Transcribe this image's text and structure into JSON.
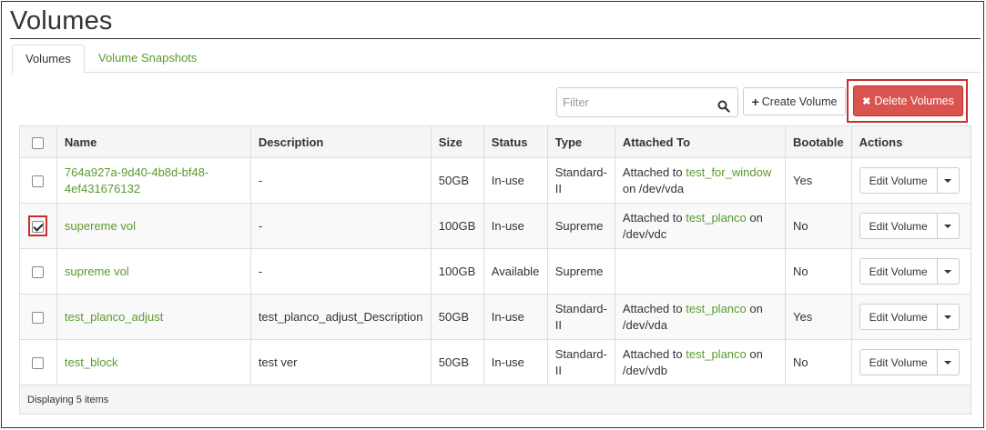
{
  "page": {
    "title": "Volumes"
  },
  "tabs": [
    {
      "label": "Volumes",
      "active": true
    },
    {
      "label": "Volume Snapshots",
      "active": false
    }
  ],
  "toolbar": {
    "filter_placeholder": "Filter",
    "create_label": "Create Volume",
    "delete_label": "Delete Volumes"
  },
  "table": {
    "headers": {
      "name": "Name",
      "description": "Description",
      "size": "Size",
      "status": "Status",
      "type": "Type",
      "attached": "Attached To",
      "bootable": "Bootable",
      "actions": "Actions"
    },
    "attached_prefix": "Attached to",
    "rows": [
      {
        "checked": false,
        "name_line1": "764a927a-9d40-4b8d-bf48-",
        "name_line2": "4ef431676132",
        "description": "-",
        "size": "50GB",
        "status": "In-use",
        "type_line1": "Standard-",
        "type_line2": "II",
        "attached_link": "test_for_window",
        "attached_on": "on /dev/vda",
        "bootable": "Yes",
        "action": "Edit Volume"
      },
      {
        "checked": true,
        "name_line1": "supereme vol",
        "name_line2": "",
        "description": "-",
        "size": "100GB",
        "status": "In-use",
        "type_line1": "Supreme",
        "type_line2": "",
        "attached_link": "test_planco",
        "attached_on": "on",
        "attached_line2": "/dev/vdc",
        "bootable": "No",
        "action": "Edit Volume"
      },
      {
        "checked": false,
        "name_line1": "supreme vol",
        "name_line2": "",
        "description": "-",
        "size": "100GB",
        "status": "Available",
        "type_line1": "Supreme",
        "type_line2": "",
        "bootable": "No",
        "action": "Edit Volume"
      },
      {
        "checked": false,
        "name_line1": "test_planco_adjust",
        "name_line2": "",
        "description": "test_planco_adjust_Description",
        "size": "50GB",
        "status": "In-use",
        "type_line1": "Standard-",
        "type_line2": "II",
        "attached_link": "test_planco",
        "attached_on": "on",
        "attached_line2": "/dev/vda",
        "bootable": "Yes",
        "action": "Edit Volume"
      },
      {
        "checked": false,
        "name_line1": "test_block",
        "name_line2": "",
        "description": "test ver",
        "size": "50GB",
        "status": "In-use",
        "type_line1": "Standard-",
        "type_line2": "II",
        "attached_link": "test_planco",
        "attached_on": "on",
        "attached_line2": "/dev/vdb",
        "bootable": "No",
        "action": "Edit Volume"
      }
    ],
    "footer": "Displaying 5 items"
  },
  "colors": {
    "link": "#5a9b2e",
    "danger": "#d9534f",
    "highlight": "#c9302c"
  }
}
